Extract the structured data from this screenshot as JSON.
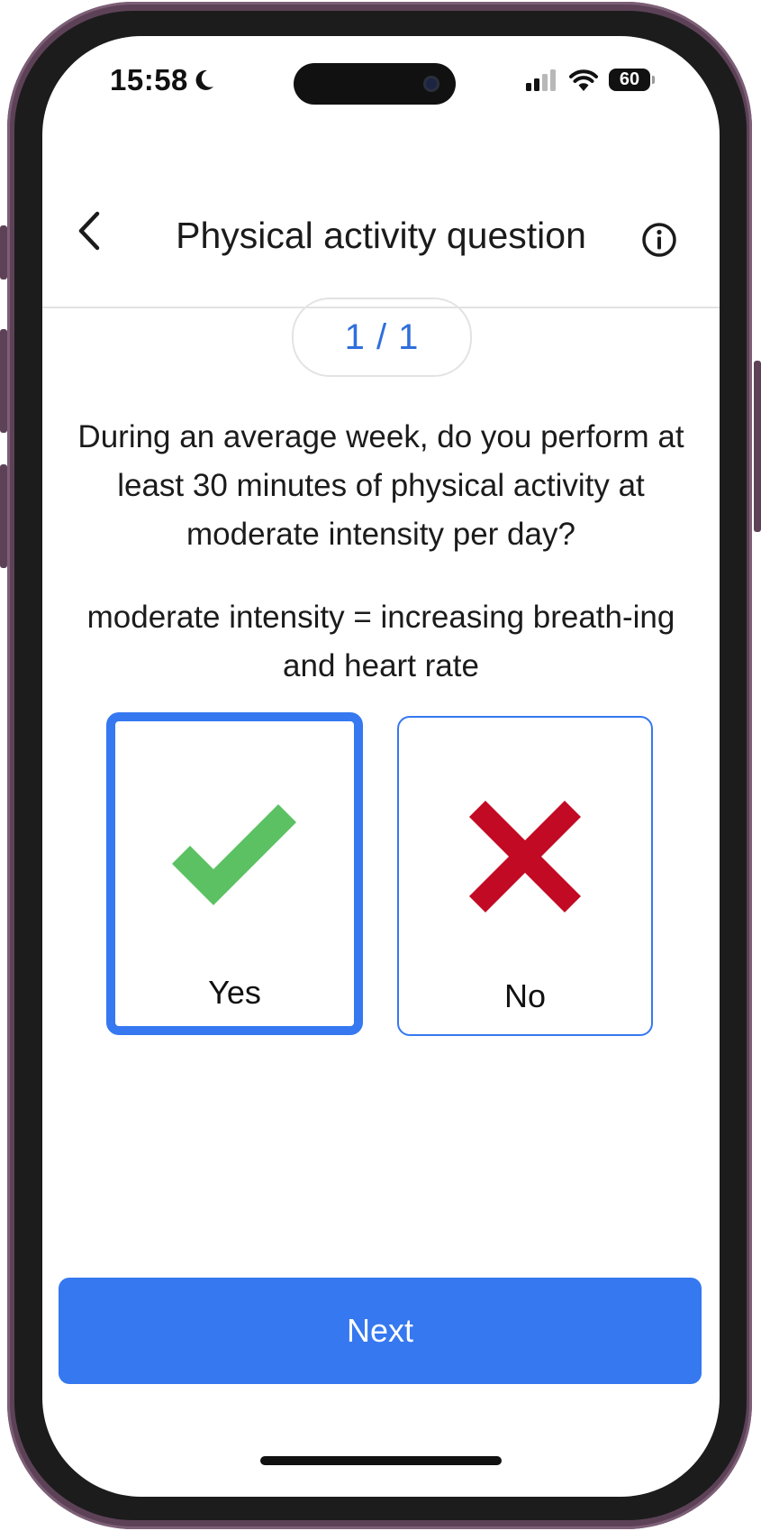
{
  "status_bar": {
    "time": "15:58",
    "focus_icon": "moon-icon",
    "battery": "60",
    "signal_icon": "cellular-signal-icon",
    "wifi_icon": "wifi-icon"
  },
  "header": {
    "title": "Physical activity question",
    "back_icon": "chevron-left-icon",
    "info_icon": "info-circle-icon"
  },
  "progress": {
    "label": "1 / 1"
  },
  "question": {
    "text": "During an average week, do you perform at least 30 minutes of physical activity at moderate intensity per day?",
    "hint": "moderate intensity = increasing breath-ing and heart rate"
  },
  "options": [
    {
      "label": "Yes",
      "icon": "checkmark-icon",
      "selected": true,
      "color": "#5cc163"
    },
    {
      "label": "No",
      "icon": "cross-icon",
      "selected": false,
      "color": "#c20a24"
    }
  ],
  "actions": {
    "next_label": "Next"
  },
  "colors": {
    "accent": "#3578f0",
    "frame": "#5d4257"
  }
}
